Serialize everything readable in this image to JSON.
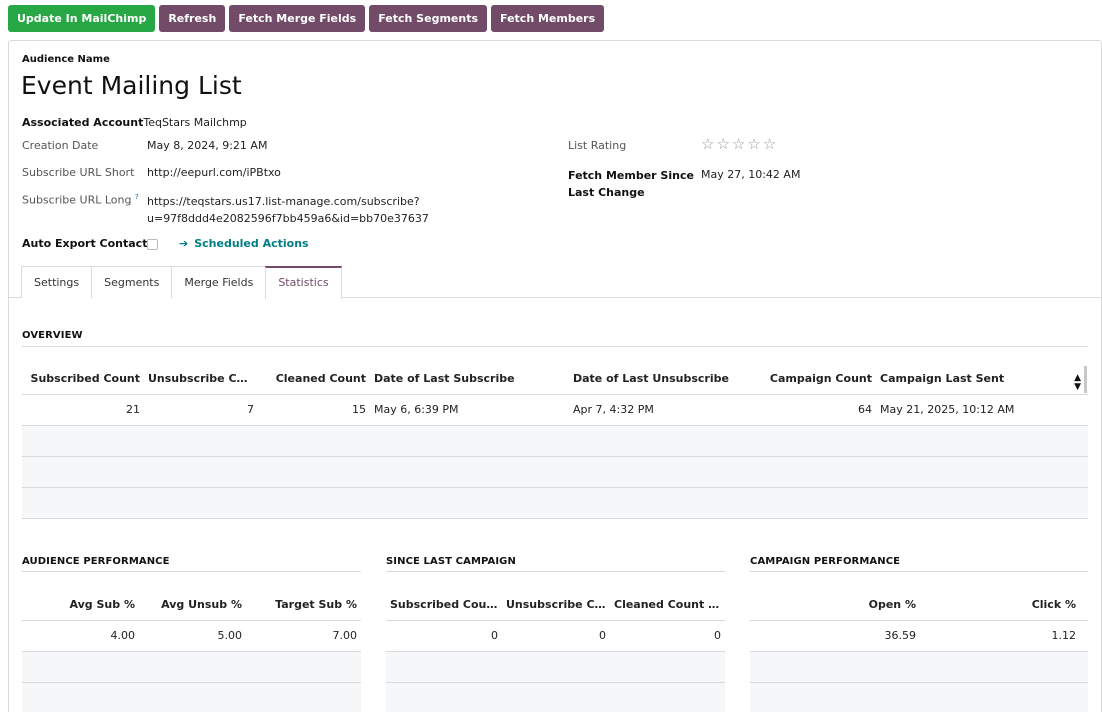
{
  "toolbar": {
    "update": "Update In MailChimp",
    "refresh": "Refresh",
    "fetch_merge_fields": "Fetch Merge Fields",
    "fetch_segments": "Fetch Segments",
    "fetch_members": "Fetch Members"
  },
  "colors": {
    "success": "#28a745",
    "primary": "#714b67",
    "link": "#017e84"
  },
  "form": {
    "audience_name_label": "Audience Name",
    "audience_name": "Event Mailing List",
    "associated_account_label": "Associated Account",
    "associated_account": "TeqStars Mailchmp",
    "creation_date_label": "Creation Date",
    "creation_date": "May 8, 2024, 9:21 AM",
    "subscribe_url_short_label": "Subscribe URL Short",
    "subscribe_url_short": "http://eepurl.com/iPBtxo",
    "subscribe_url_long_label": "Subscribe URL Long",
    "help_mark": "?",
    "subscribe_url_long_line1": "https://teqstars.us17.list-manage.com/subscribe?",
    "subscribe_url_long_line2": "u=97f8ddd4e2082596f7bb459a6&id=bb70e37637",
    "auto_export_label": "Auto Export Contact?",
    "scheduled_actions": "Scheduled Actions",
    "list_rating_label": "List Rating",
    "list_rating": 0,
    "list_rating_max": 5,
    "fetch_member_since_label_line1": "Fetch Member Since",
    "fetch_member_since_label_line2": "Last Change",
    "fetch_member_since": "May 27, 10:42 AM"
  },
  "tabs": [
    "Settings",
    "Segments",
    "Merge Fields",
    "Statistics"
  ],
  "active_tab": "Statistics",
  "overview": {
    "title": "OVERVIEW",
    "headers": [
      "Subscribed Count",
      "Unsubscribe Count",
      "Cleaned Count",
      "Date of Last Subscribe",
      "Date of Last Unsubscribe",
      "Campaign Count",
      "Campaign Last Sent"
    ],
    "row": [
      "21",
      "7",
      "15",
      "May 6, 6:39 PM",
      "Apr 7, 4:32 PM",
      "64",
      "May 21, 2025, 10:12 AM"
    ]
  },
  "audience_performance": {
    "title": "AUDIENCE PERFORMANCE",
    "headers": [
      "Avg Sub %",
      "Avg Unsub %",
      "Target Sub %"
    ],
    "row": [
      "4.00",
      "5.00",
      "7.00"
    ]
  },
  "since_last_campaign": {
    "title": "SINCE LAST CAMPAIGN",
    "headers": [
      "Subscribed Coun...",
      "Unsubscribe Count",
      "Cleaned Count S..."
    ],
    "row": [
      "0",
      "0",
      "0"
    ]
  },
  "campaign_performance": {
    "title": "CAMPAIGN PERFORMANCE",
    "headers": [
      "Open %",
      "Click %"
    ],
    "row": [
      "36.59",
      "1.12"
    ]
  }
}
